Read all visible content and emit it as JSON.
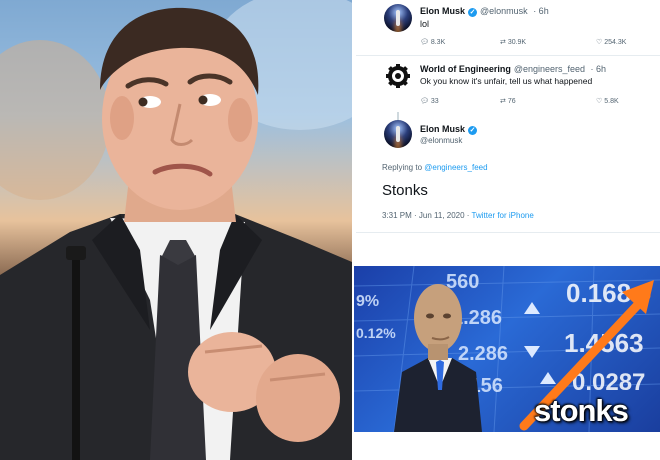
{
  "tweets": [
    {
      "name": "Elon Musk",
      "handle": "@elonmusk",
      "time": "· 6h",
      "text": "lol",
      "replies": "8.3K",
      "retweets": "30.9K",
      "likes": "254.3K"
    },
    {
      "name": "World of Engineering",
      "handle": "@engineers_feed",
      "time": "· 6h",
      "text": "Ok you know it's unfair, tell us what happened",
      "replies": "33",
      "retweets": "76",
      "likes": "5.8K"
    }
  ],
  "main_tweet": {
    "name": "Elon Musk",
    "handle": "@elonmusk",
    "replying_prefix": "Replying to",
    "replying_to": "@engineers_feed",
    "text": "Stonks",
    "timestamp": "3:31 PM · Jun 11, 2020 ·",
    "app": "Twitter for iPhone"
  },
  "meme": {
    "caption": "stonks",
    "ticker_values": [
      "560",
      "0.168",
      "1.286",
      "2.286",
      "1.4563",
      ".156",
      "0.0287",
      "9%",
      "0.12%"
    ]
  },
  "colors": {
    "twitter_blue": "#1d9bf0",
    "text_primary": "#0f1419",
    "text_secondary": "#536471",
    "arrow_orange": "#ff7a1a"
  }
}
